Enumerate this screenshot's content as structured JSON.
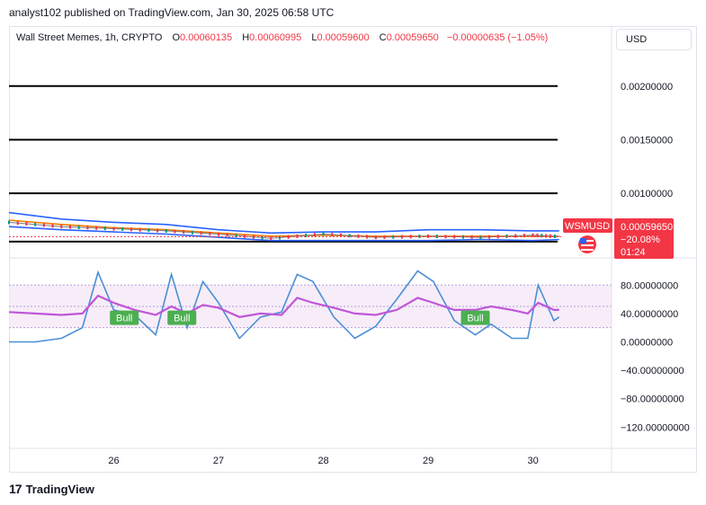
{
  "header": {
    "publisher": "analyst102 published on TradingView.com, Jan 30, 2025 06:58 UTC"
  },
  "legend": {
    "symbol": "Wall Street Memes, 1h, CRYPTO",
    "open_label": "O",
    "open": "0.00060135",
    "high_label": "H",
    "high": "0.00060995",
    "low_label": "L",
    "low": "0.00059600",
    "close_label": "C",
    "close": "0.00059650",
    "change": "−0.00000635 (−1.05%)"
  },
  "currency_button": "USD",
  "price_badge": {
    "ticker": "WSMUSD",
    "price": "0.00059650",
    "change_pct": "−20.08%",
    "countdown": "01:24"
  },
  "footer": {
    "brand": "TradingView"
  },
  "colors": {
    "up": "#089981",
    "down": "#f23645",
    "bollinger": "#2962ff",
    "ma_orange": "#f57c00",
    "stoch_k": "#4a8fd6",
    "stoch_d": "#c056d8",
    "bull_badge": "#4caf50",
    "level_line": "#000000"
  },
  "chart_data": [
    {
      "type": "line",
      "title": "Wall Street Memes, 1h, CRYPTO",
      "yaxis_ticks": [
        "0.00200000",
        "0.00150000",
        "0.00100000"
      ],
      "ylim": [
        0.00044,
        0.0023
      ],
      "x_ticks": [
        "26",
        "27",
        "28",
        "29",
        "30"
      ],
      "horizontal_levels": [
        0.002,
        0.0015,
        0.001,
        0.00055
      ],
      "x": [
        25.0,
        25.5,
        26.0,
        26.5,
        27.0,
        27.5,
        28.0,
        28.5,
        29.0,
        29.5,
        30.0,
        30.25
      ],
      "series": [
        {
          "role": "upper_band",
          "values": [
            0.00082,
            0.00076,
            0.00073,
            0.00071,
            0.00066,
            0.00063,
            0.00064,
            0.00064,
            0.00066,
            0.00066,
            0.00065,
            0.00065
          ]
        },
        {
          "role": "ma",
          "values": [
            0.00075,
            0.00071,
            0.00068,
            0.00066,
            0.00063,
            0.0006,
            0.00061,
            0.0006,
            0.0006,
            0.0006,
            0.0006,
            0.0006
          ]
        },
        {
          "role": "lower_band",
          "values": [
            0.00069,
            0.00066,
            0.00064,
            0.00062,
            0.00059,
            0.00056,
            0.00056,
            0.00056,
            0.00056,
            0.00057,
            0.00056,
            0.00057
          ]
        },
        {
          "role": "close",
          "values": [
            0.00073,
            0.00069,
            0.00067,
            0.00065,
            0.00062,
            0.00058,
            0.00062,
            0.00059,
            0.0006,
            0.00059,
            0.00061,
            0.0005965
          ]
        }
      ]
    },
    {
      "type": "line",
      "yaxis_ticks": [
        "80.00000000",
        "40.00000000",
        "0.00000000",
        "−40.00000000",
        "−80.00000000",
        "−120.00000000"
      ],
      "ylim": [
        -145,
        112
      ],
      "bands": [
        20,
        80
      ],
      "x": [
        25.0,
        25.25,
        25.5,
        25.7,
        25.85,
        26.0,
        26.2,
        26.4,
        26.55,
        26.7,
        26.85,
        27.0,
        27.2,
        27.4,
        27.6,
        27.75,
        27.9,
        28.1,
        28.3,
        28.5,
        28.7,
        28.9,
        29.05,
        29.25,
        29.45,
        29.6,
        29.8,
        29.95,
        30.05,
        30.2,
        30.25
      ],
      "series": [
        {
          "role": "stoch_k",
          "values": [
            0,
            0,
            5,
            20,
            98,
            45,
            38,
            10,
            95,
            20,
            85,
            55,
            5,
            35,
            42,
            95,
            85,
            35,
            5,
            22,
            60,
            100,
            85,
            30,
            10,
            25,
            5,
            5,
            80,
            30,
            35
          ]
        },
        {
          "role": "stoch_d",
          "values": [
            42,
            40,
            38,
            40,
            65,
            55,
            45,
            38,
            50,
            40,
            52,
            48,
            35,
            40,
            38,
            62,
            55,
            48,
            40,
            38,
            45,
            62,
            55,
            45,
            45,
            50,
            45,
            40,
            55,
            45,
            45
          ]
        }
      ],
      "annotations": [
        {
          "text": "Bull",
          "x": 26.1
        },
        {
          "text": "Bull",
          "x": 26.65
        },
        {
          "text": "Bull",
          "x": 29.45
        }
      ]
    }
  ]
}
